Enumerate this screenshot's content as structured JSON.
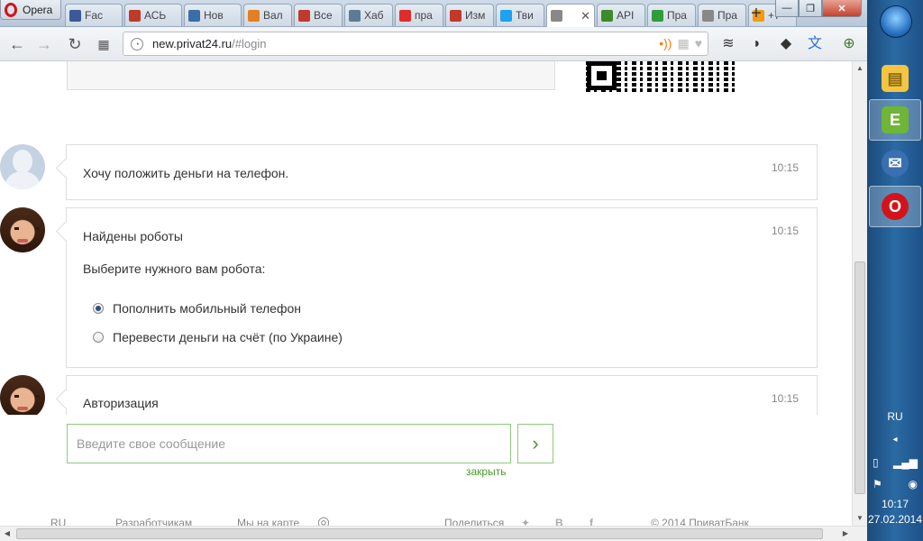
{
  "browser": {
    "menu_label": "Opera",
    "tabs": [
      {
        "label": "Fac",
        "icon": "facebook-icon",
        "color": "#3b5998"
      },
      {
        "label": "АСЬ",
        "icon": "puzzle-icon",
        "color": "#c0392b"
      },
      {
        "label": "Нов",
        "icon": "shield-icon",
        "color": "#3a6ea5"
      },
      {
        "label": "Вал",
        "icon": "grid-icon",
        "color": "#e67e22"
      },
      {
        "label": "Все",
        "icon": "puzzle-icon",
        "color": "#c0392b"
      },
      {
        "label": "Хаб",
        "icon": "habr-icon",
        "color": "#5b7b99"
      },
      {
        "label": "пра",
        "icon": "yandex-icon",
        "color": "#e12c2c"
      },
      {
        "label": "Изм",
        "icon": "puzzle-icon",
        "color": "#c0392b"
      },
      {
        "label": "Тви",
        "icon": "twitter-icon",
        "color": "#1da1f2"
      },
      {
        "label": "",
        "icon": "page-icon",
        "color": "#888888",
        "active": true
      },
      {
        "label": "API",
        "icon": "api-icon",
        "color": "#3d8b2a"
      },
      {
        "label": "Пра",
        "icon": "leaf-icon",
        "color": "#2e9e3a"
      },
      {
        "label": "Пра",
        "icon": "page-icon",
        "color": "#888888"
      },
      {
        "label": "+7",
        "icon": "chat-icon",
        "color": "#f39c12"
      }
    ],
    "new_tab_symbol": "+",
    "url_host": "new.privat24.ru",
    "url_path": "/#login"
  },
  "chat": {
    "messages": [
      {
        "author": "user",
        "text": "Хочу положить деньги на телефон.",
        "time": "10:15"
      },
      {
        "author": "bot",
        "title": "Найдены роботы",
        "text": "Выберите нужного вам робота:",
        "time": "10:15",
        "options": [
          {
            "label": "Пополнить мобильный телефон",
            "checked": true
          },
          {
            "label": "Перевести деньги на счёт (по Украине)",
            "checked": false
          }
        ]
      },
      {
        "author": "bot",
        "title": "Авторизация",
        "time": "10:15"
      }
    ],
    "input_placeholder": "Введите свое сообщение",
    "send_symbol": "›",
    "close_label": "закрыть"
  },
  "footer": {
    "lang": "RU",
    "developers": "Разработчикам",
    "map": "Мы на карте",
    "share": "Поделиться",
    "copyright": "© 2014 ПриватБанк"
  },
  "taskbar": {
    "lang": "RU",
    "time": "10:17",
    "date": "27.02.2014"
  }
}
